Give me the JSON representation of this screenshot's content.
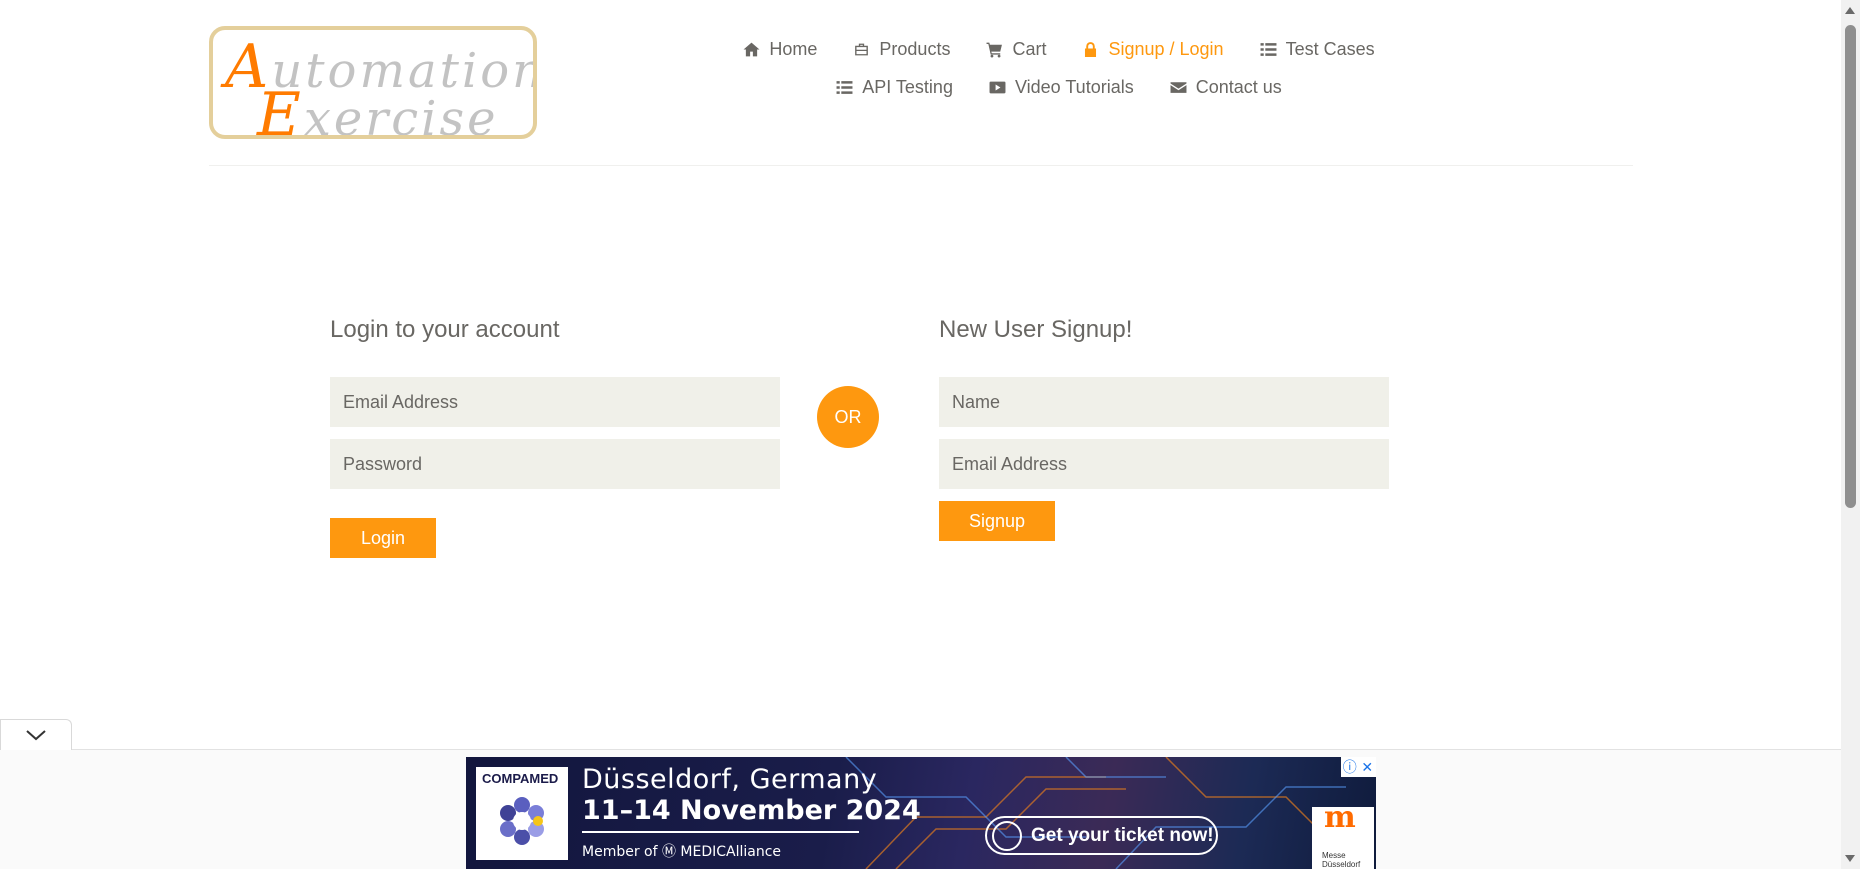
{
  "logo": {
    "line1_cap": "A",
    "line1_rest": "utomation",
    "line2_cap": "E",
    "line2_rest": "xercise"
  },
  "nav": {
    "items": [
      {
        "label": "Home",
        "icon": "home-icon"
      },
      {
        "label": "Products",
        "icon": "briefcase-icon"
      },
      {
        "label": "Cart",
        "icon": "shopping-cart-icon"
      },
      {
        "label": "Signup / Login",
        "icon": "lock-icon",
        "active": true
      },
      {
        "label": "Test Cases",
        "icon": "list-icon"
      },
      {
        "label": "API Testing",
        "icon": "list-icon"
      },
      {
        "label": "Video Tutorials",
        "icon": "youtube-play-icon"
      },
      {
        "label": "Contact us",
        "icon": "envelope-icon"
      }
    ],
    "active_color": "#fe980f"
  },
  "login": {
    "title": "Login to your account",
    "email_placeholder": "Email Address",
    "password_placeholder": "Password",
    "button": "Login"
  },
  "or_label": "OR",
  "signup": {
    "title": "New User Signup!",
    "name_placeholder": "Name",
    "email_placeholder": "Email Address",
    "button": "Signup"
  },
  "ad": {
    "brand": "COMPAMED",
    "city": "Düsseldorf, Germany",
    "dates": "11–14 November 2024",
    "member": "Member of Ⓜ MEDICAlliance",
    "cta": "Get your ticket now!",
    "messe_line1": "Messe",
    "messe_line2": "Düsseldorf",
    "info_icon": "info-icon",
    "close_icon": "close-icon"
  },
  "colors": {
    "accent": "#fe980f",
    "text": "#696763",
    "field_bg": "#f0f0e9"
  }
}
